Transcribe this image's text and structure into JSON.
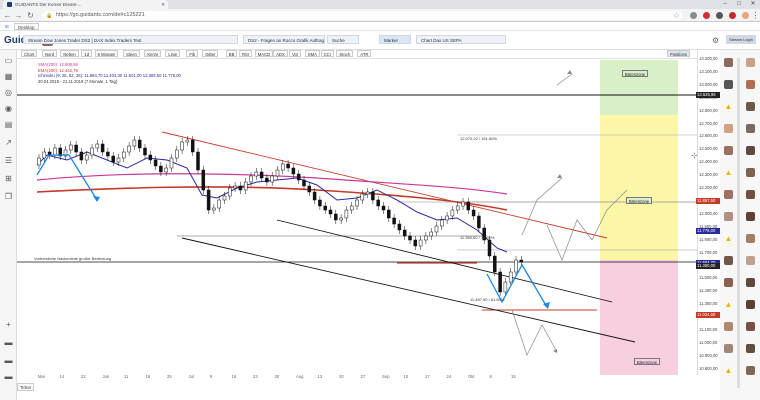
{
  "browser": {
    "tab_title": "GUIDANTS Der Korner Dream-...",
    "url": "https://go.guidants.com/de#c125221"
  },
  "bookmarks": [
    {
      "label": "Desktop"
    }
  ],
  "app": {
    "logo": "Guidants"
  },
  "chart_tabs": [
    {
      "label": "Stream Dow Jones Trader DS2 | DAX Index Traders Test"
    },
    {
      "label": "DS2 - Fragen an Rocco Grafik Auftrag Technologie"
    },
    {
      "label": "Suche"
    },
    {
      "label": "Marker"
    },
    {
      "label": "Chart Dax US SEPA"
    }
  ],
  "toolbar": [
    {
      "label": "Chart"
    },
    {
      "label": "Nord"
    },
    {
      "label": "Neben"
    },
    {
      "label": "1d"
    },
    {
      "label": "6 Monate"
    },
    {
      "label": "Ideen"
    },
    {
      "label": "Kerze"
    },
    {
      "label": "Linie"
    },
    {
      "label": "Fib"
    },
    {
      "label": "Gitter"
    },
    {
      "label": "BB"
    },
    {
      "label": "RSI"
    },
    {
      "label": "MACD"
    },
    {
      "label": "ADX"
    },
    {
      "label": "Vol"
    },
    {
      "label": "SMA"
    },
    {
      "label": "CCI"
    },
    {
      "label": "Stoch"
    },
    {
      "label": "ATR"
    }
  ],
  "toolbar_right": "Positions",
  "legend": [
    {
      "text": "SMA(200): 12.508,56",
      "color": "#c8389b"
    },
    {
      "text": "EMA(200): 12.442,79",
      "color": "#c43b2a"
    },
    {
      "text": "Ichimoku (9, 26, 52, 26): 11.884,70   11.404,30   11.601,00   12.308,50   11.776,00",
      "color": "#2a2a9a"
    },
    {
      "text": "30.04.2018 - 21.11.2018   (7 Monate, 1 Tag)",
      "color": "#333333"
    }
  ],
  "chart_annotations": {
    "upper_label": "12.070,22 / 161.80%",
    "support_label": "Vorbörsliche Nackenlinie großer Bedeutung",
    "fib_label_a": "11.350,00 / 78.60%",
    "fib_label_b": "11.487,90 / 61.80%",
    "zone_top": "Bärenzone",
    "zone_mid": "Bärenzone",
    "zone_bottom": "Bärenzone"
  },
  "price_axis": [
    "13.200,00",
    "13.100,00",
    "13.000,00",
    "12.900,00",
    "12.800,00",
    "12.700,00",
    "12.600,00",
    "12.500,00",
    "12.400,00",
    "12.300,00",
    "12.200,00",
    "12.100,00",
    "12.000,00",
    "11.900,00",
    "11.800,00",
    "11.700,00",
    "11.600,00",
    "11.500,00",
    "11.400,00",
    "11.300,00",
    "11.200,00",
    "11.100,00",
    "11.000,00",
    "10.900,00",
    "10.800,00"
  ],
  "price_tags": [
    {
      "label": "13.525,95",
      "color": "#222222"
    },
    {
      "label": "11.857,50",
      "color": "#c43b2a"
    },
    {
      "label": "11.776,00",
      "color": "#2a2a9a"
    },
    {
      "label": "11.604,70",
      "color": "#2a2a9a"
    },
    {
      "label": "11.350,00",
      "color": "#222222"
    },
    {
      "label": "11.024,50",
      "color": "#c43b2a"
    }
  ],
  "x_axis": [
    "Mai",
    "14",
    "22",
    "Jun",
    "11",
    "18",
    "25",
    "Jul",
    "9",
    "16",
    "23",
    "30",
    "Aug",
    "13",
    "20",
    "27",
    "Sep",
    "10",
    "17",
    "24",
    "Okt",
    "8",
    "15"
  ],
  "bottom": {
    "label": "Ticker"
  },
  "colors": {
    "zone_green": "#d8efc8",
    "zone_yellow": "#fbf6a8",
    "zone_pink": "#f8cfe0",
    "accent": "#0a8ad8"
  }
}
